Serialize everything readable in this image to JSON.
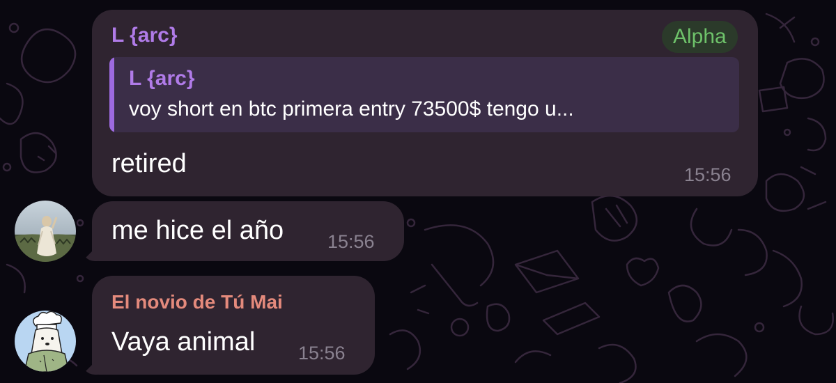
{
  "messages": [
    {
      "sender": "L {arc}",
      "tag": "Alpha",
      "reply": {
        "sender": "L {arc}",
        "text": "voy short en btc primera entry 73500$ tengo u..."
      },
      "text": "retired",
      "time": "15:56"
    },
    {
      "text": "me hice el año",
      "time": "15:56",
      "avatar": "statue-photo-avatar"
    },
    {
      "sender": "El novio de Tú Mai",
      "text": "Vaya animal",
      "time": "15:56",
      "avatar": "chef-cartoon-avatar"
    }
  ],
  "colors": {
    "background": "#0a0810",
    "bubble": "#2f2430",
    "sender_purple": "#b07be8",
    "sender_salmon": "#e48a7c",
    "tag_green": "#6ec26a",
    "timestamp": "#8a8290"
  }
}
